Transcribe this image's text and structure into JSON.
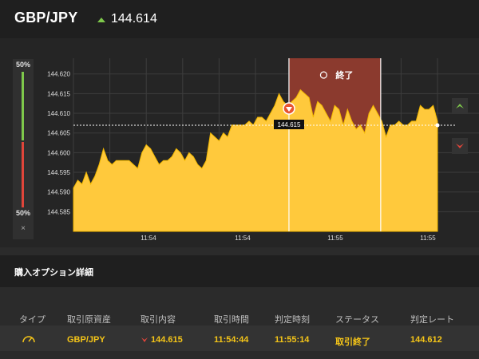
{
  "header": {
    "pair": "GBP/JPY",
    "rate": "144.614",
    "up_color": "#7ec84b"
  },
  "gauge": {
    "top_label": "50%",
    "bottom_label": "50%",
    "close_label": "×"
  },
  "chart_data": {
    "type": "area",
    "title": "",
    "xlabel": "",
    "ylabel": "",
    "ylim": [
      144.58,
      144.624
    ],
    "y_ticks": [
      144.585,
      144.59,
      144.595,
      144.6,
      144.605,
      144.61,
      144.615,
      144.62
    ],
    "x_tick_labels": [
      "11:54",
      "11:54",
      "11:55",
      "11:55"
    ],
    "fill_color": "#ffc93c",
    "end_window_label": "終了",
    "current_rate_marker": "144.615",
    "series": [
      {
        "values": [
          144.591,
          144.593,
          144.592,
          144.595,
          144.592,
          144.594,
          144.597,
          144.601,
          144.598,
          144.597,
          144.598,
          144.598,
          144.598,
          144.598,
          144.597,
          144.596,
          144.6,
          144.602,
          144.601,
          144.599,
          144.597,
          144.598,
          144.598,
          144.599,
          144.601,
          144.6,
          144.598,
          144.6,
          144.599,
          144.597,
          144.596,
          144.598,
          144.605,
          144.604,
          144.603,
          144.605,
          144.604,
          144.607,
          144.607,
          144.607,
          144.607,
          144.608,
          144.607,
          144.609,
          144.609,
          144.608,
          144.61,
          144.612,
          144.615,
          144.613,
          144.612,
          144.613,
          144.614,
          144.616,
          144.615,
          144.614,
          144.609,
          144.613,
          144.612,
          144.61,
          144.608,
          144.612,
          144.611,
          144.607,
          144.611,
          144.608,
          144.606,
          144.607,
          144.605,
          144.61,
          144.612,
          144.61,
          144.608,
          144.604,
          144.607,
          144.607,
          144.608,
          144.607,
          144.607,
          144.608,
          144.608,
          144.612,
          144.611,
          144.611,
          144.612,
          144.608
        ]
      }
    ]
  },
  "section": {
    "title": "購入オプション詳細"
  },
  "table": {
    "headers": [
      "タイプ",
      "取引原資産",
      "取引内容",
      "取引時間",
      "判定時刻",
      "ステータス",
      "判定レート"
    ],
    "row": {
      "type_icon": "gauge-icon",
      "asset": "GBP/JPY",
      "content": "144.615",
      "time": "11:54:44",
      "judge_time": "11:55:14",
      "status": "取引終了",
      "rate": "144.612"
    }
  }
}
